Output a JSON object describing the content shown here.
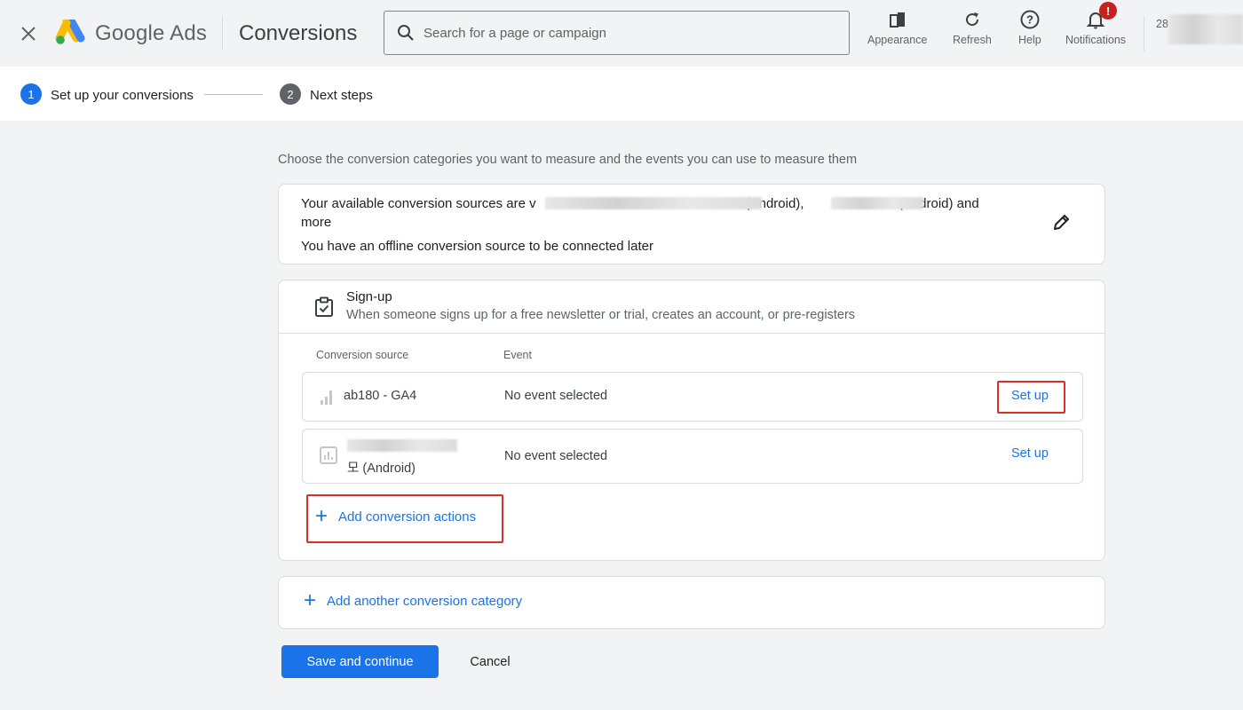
{
  "header": {
    "brand": "Google Ads",
    "page_title": "Conversions",
    "search_placeholder": "Search for a page or campaign",
    "tools": {
      "appearance": "Appearance",
      "refresh": "Refresh",
      "help": "Help",
      "notifications": "Notifications",
      "notifications_badge": "!"
    },
    "account_partial": "28"
  },
  "stepper": {
    "steps": [
      {
        "number": "1",
        "label": "Set up your conversions"
      },
      {
        "number": "2",
        "label": "Next steps"
      }
    ]
  },
  "main": {
    "intro": "Choose the conversion categories you want to measure and the events you can use to measure them",
    "sources_card": {
      "line1_prefix": "Your available conversion sources are ",
      "line1_partial": "v",
      "android_1": "(Android),",
      "android_2": "(Android) and",
      "line1_suffix": "more",
      "line2": "You have an offline conversion source to be connected later"
    },
    "category": {
      "title": "Sign-up",
      "description": "When someone signs up for a free newsletter or trial, creates an account, or pre-registers",
      "col_source": "Conversion source",
      "col_event": "Event",
      "rows": [
        {
          "source": "ab180 - GA4",
          "event": "No event selected",
          "action": "Set up"
        },
        {
          "source": "모 (Android)",
          "event": "No event selected",
          "action": "Set up"
        }
      ],
      "add_actions": "Add conversion actions"
    },
    "add_category": "Add another conversion category"
  },
  "footer": {
    "save": "Save and continue",
    "cancel": "Cancel"
  },
  "colors": {
    "accent": "#1a73e8",
    "highlight": "#d93025",
    "background": "#f1f3f4"
  }
}
